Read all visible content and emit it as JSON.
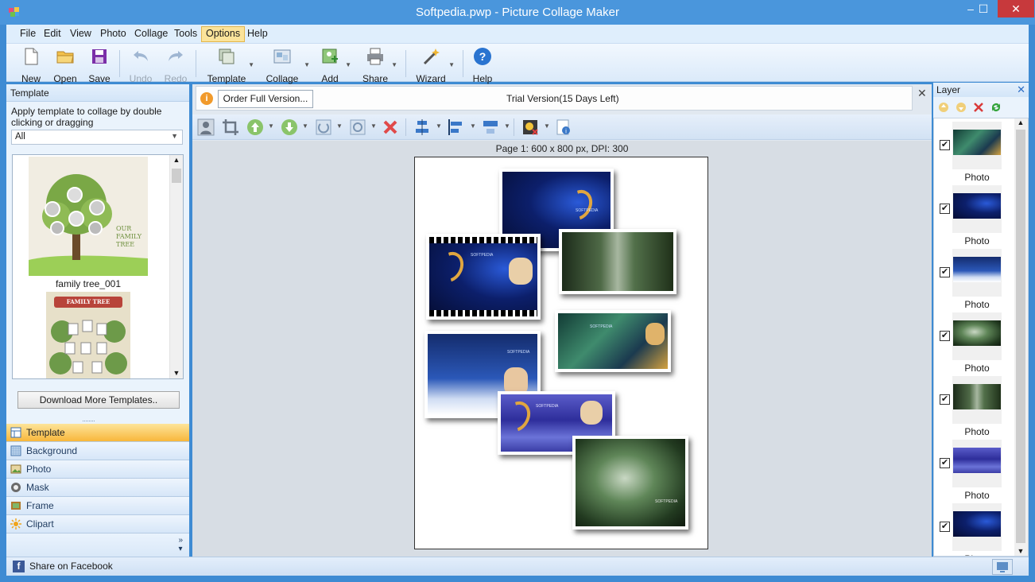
{
  "window": {
    "title": "Softpedia.pwp - Picture Collage Maker",
    "min": "–",
    "max": "☐",
    "close": "✕"
  },
  "menu": [
    "File",
    "Edit",
    "View",
    "Photo",
    "Collage",
    "Tools",
    "Options",
    "Help"
  ],
  "menu_active": "Options",
  "toolbar": {
    "new": "New",
    "open": "Open",
    "save": "Save",
    "undo": "Undo",
    "redo": "Redo",
    "template": "Template",
    "collage": "Collage",
    "add": "Add",
    "share": "Share",
    "wizard": "Wizard",
    "help": "Help"
  },
  "template_panel": {
    "header": "Template",
    "description": "Apply template to collage by double clicking or dragging",
    "filter": "All",
    "items": [
      {
        "label": "family tree_001",
        "caption": "OUR FAMILY TREE"
      },
      {
        "label": "",
        "caption": "FAMILY TREE"
      }
    ],
    "download_button": "Download More Templates.."
  },
  "nav": [
    {
      "label": "Template",
      "icon": "template-icon"
    },
    {
      "label": "Background",
      "icon": "background-icon"
    },
    {
      "label": "Photo",
      "icon": "photo-icon"
    },
    {
      "label": "Mask",
      "icon": "mask-icon"
    },
    {
      "label": "Frame",
      "icon": "frame-icon"
    },
    {
      "label": "Clipart",
      "icon": "clipart-icon"
    }
  ],
  "nav_active": "Template",
  "infobar": {
    "order_button": "Order Full Version...",
    "trial_text": "Trial Version(15 Days Left)"
  },
  "canvas": {
    "page_info": "Page 1: 600 x 800 px, DPI: 300",
    "photo_text": "SOFTPEDIA"
  },
  "layer_panel": {
    "header": "Layer",
    "layers": [
      {
        "name": "Photo",
        "checked": true,
        "style": "green"
      },
      {
        "name": "Photo",
        "checked": true,
        "style": "blue"
      },
      {
        "name": "Photo",
        "checked": true,
        "style": "snow"
      },
      {
        "name": "Photo",
        "checked": true,
        "style": "forest2"
      },
      {
        "name": "Photo",
        "checked": true,
        "style": "forest"
      },
      {
        "name": "Photo",
        "checked": true,
        "style": "purple"
      },
      {
        "name": "Photo",
        "checked": true,
        "style": "blue"
      }
    ]
  },
  "statusbar": {
    "facebook": "Share on Facebook"
  },
  "colors": {
    "titlebar": "#4a96dc",
    "accent_active": "#f8b73b",
    "close_button": "#c7393c"
  }
}
